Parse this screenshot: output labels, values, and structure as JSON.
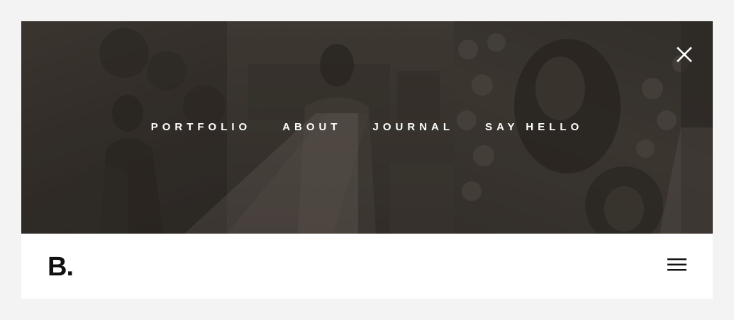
{
  "nav": {
    "items": [
      {
        "label": "PORTFOLIO"
      },
      {
        "label": "ABOUT"
      },
      {
        "label": "JOURNAL"
      },
      {
        "label": "SAY HELLO"
      }
    ]
  },
  "header": {
    "logo": "B."
  },
  "icons": {
    "close": "close-icon",
    "menu": "hamburger-menu-icon"
  },
  "colors": {
    "page_background": "#f3f3f3",
    "hero_overlay": "#3a3633",
    "nav_text": "#ffffff",
    "logo_text": "#111111"
  }
}
